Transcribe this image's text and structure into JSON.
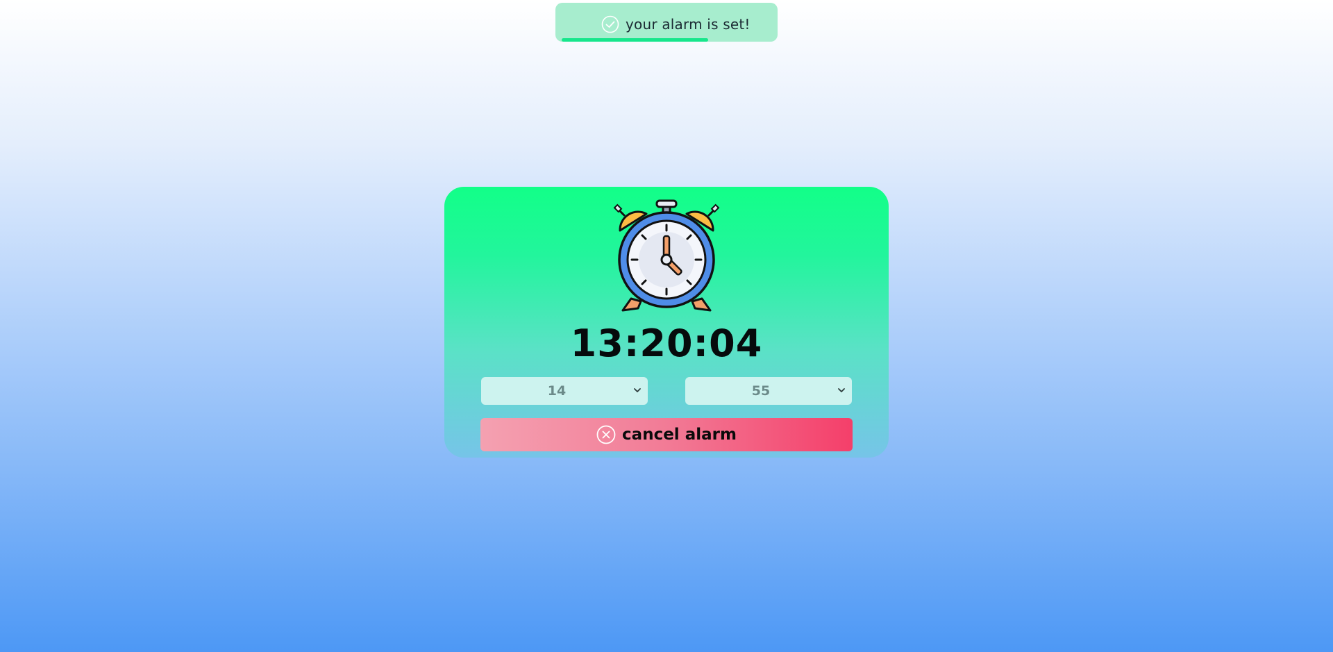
{
  "toast": {
    "message": "your alarm is set!",
    "icon": "check-circle-icon",
    "progress": 0.7,
    "colors": {
      "background": "#a7edce",
      "progress": "#17e68c"
    }
  },
  "clock": {
    "icon": "alarm-clock-icon",
    "time": "13:20:04"
  },
  "alarm": {
    "hour": "14",
    "minute": "55"
  },
  "cancel_button": {
    "label": "cancel alarm",
    "icon": "close-circle-icon"
  },
  "colors": {
    "card_top": "#12ff88",
    "card_bottom": "#76c4e8",
    "button_start": "#f4a1b1",
    "button_end": "#f43f6a"
  }
}
